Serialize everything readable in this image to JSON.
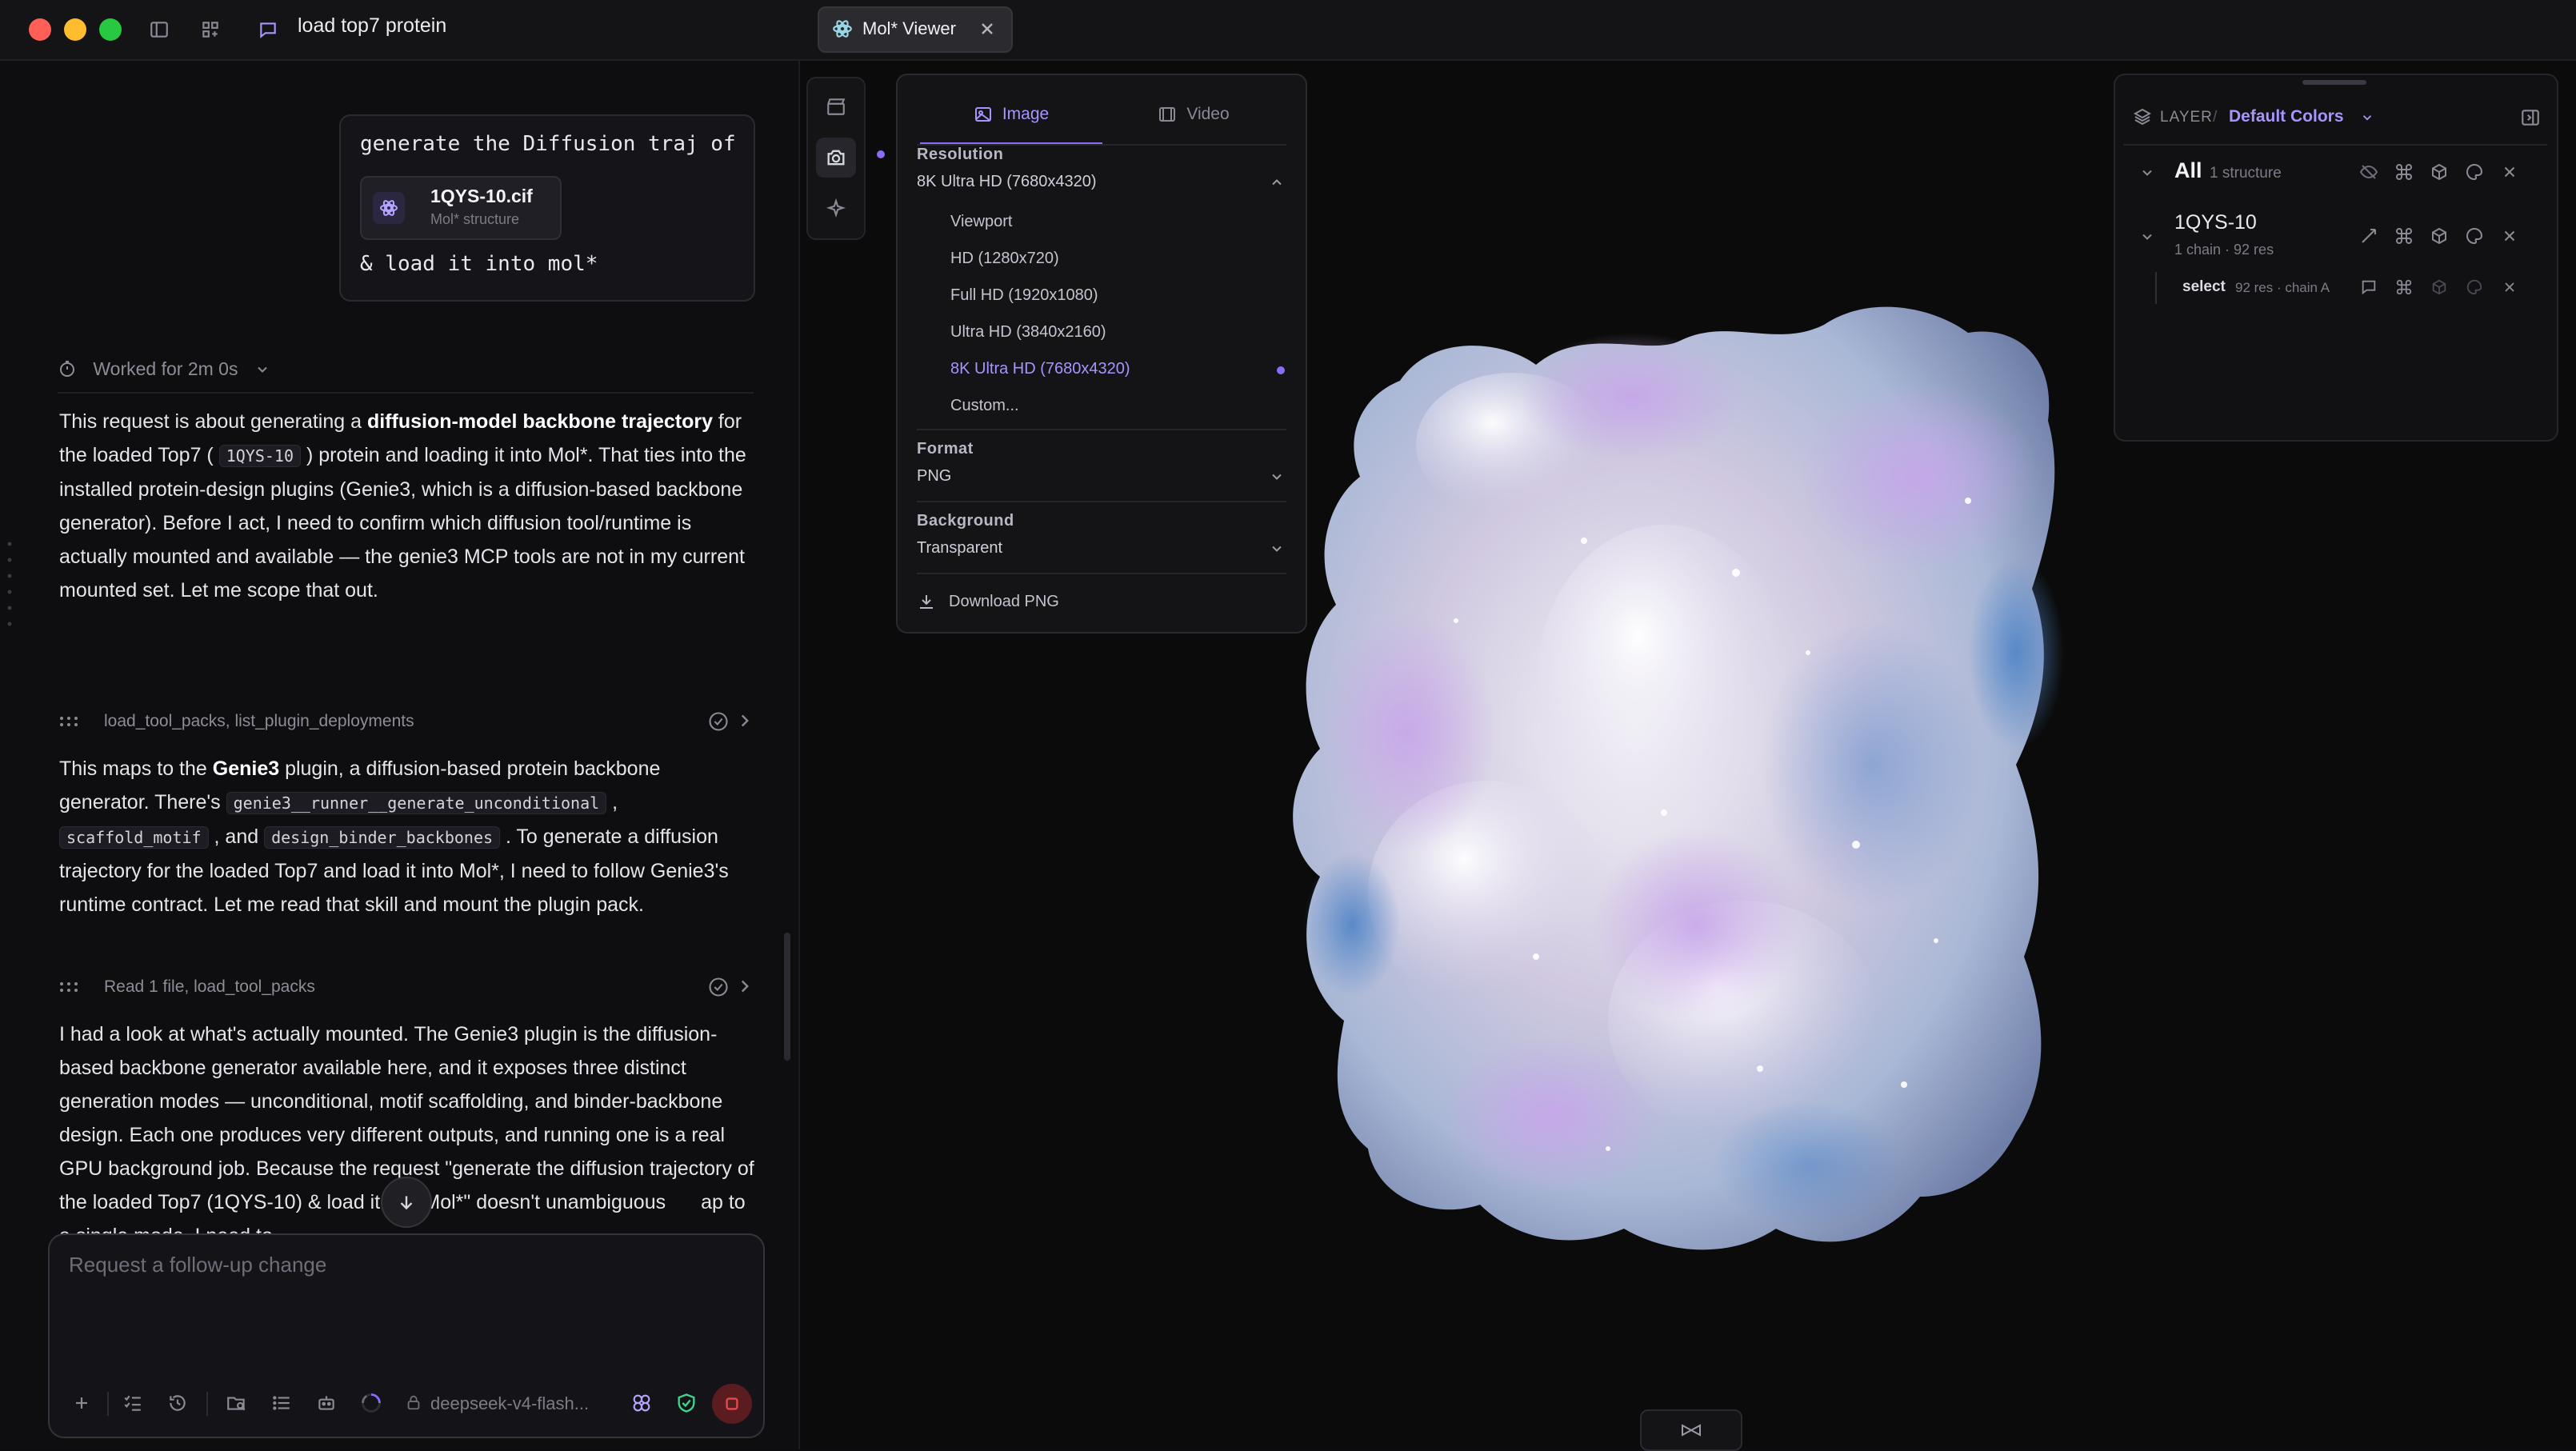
{
  "window": {
    "conversation_title": "load top7 protein",
    "viewer_tab_label": "Mol* Viewer"
  },
  "chat": {
    "user_message": {
      "line1": "generate the Diffusion traj of",
      "file_name": "1QYS-10.cif",
      "file_type": "Mol* structure",
      "line2": "& load it into mol*"
    },
    "worked_label": "Worked for 2m 0s",
    "p1": {
      "a": "This request is about generating a ",
      "b1": "diffusion-model backbone trajectory",
      "c": " for the loaded Top7 ( ",
      "code": "1QYS-10",
      "d": " ) protein and loading it into Mol*. That ties into the installed protein-design plugins (Genie3, which is a diffusion-based backbone generator). Before I act, I need to confirm which diffusion tool/runtime is actually mounted and available — the genie3 MCP tools are not in my current mounted set. Let me scope that out."
    },
    "tool1": "load_tool_packs, list_plugin_deployments",
    "p2": {
      "a": "This maps to the ",
      "b1": "Genie3",
      "c": " plugin, a diffusion-based protein backbone generator. There's ",
      "code1": "genie3__runner__generate_unconditional",
      "d": " , ",
      "code2": "scaffold_motif",
      "e": " , and ",
      "code3": "design_binder_backbones",
      "f": " . To generate a diffusion trajectory for the loaded Top7 and load it into Mol*, I need to follow Genie3's runtime contract. Let me read that skill and mount the plugin pack."
    },
    "tool2": "Read 1 file, load_tool_packs",
    "p3": "I had a look at what's actually mounted. The Genie3 plugin is the diffusion-based backbone generator available here, and it exposes three distinct generation modes — unconditional, motif scaffolding, and binder-backbone design. Each one produces very different outputs, and running one is a real GPU background job. Because the request \"generate the diffusion trajectory of the loaded Top7 (1QYS-10) & load it into Mol*\" doesn't unambiguous",
    "p3_end": "ap to a single mode, I need to",
    "composer": {
      "placeholder": "Request a follow-up change",
      "model": "deepseek-v4-flash..."
    }
  },
  "export_panel": {
    "tabs": [
      "Image",
      "Video"
    ],
    "active_tab": "Image",
    "resolution": {
      "label": "Resolution",
      "value": "8K Ultra HD (7680x4320)",
      "options": [
        "Viewport",
        "HD (1280x720)",
        "Full HD (1920x1080)",
        "Ultra HD (3840x2160)",
        "8K Ultra HD (7680x4320)",
        "Custom..."
      ],
      "selected": "8K Ultra HD (7680x4320)"
    },
    "format": {
      "label": "Format",
      "value": "PNG"
    },
    "background": {
      "label": "Background",
      "value": "Transparent"
    },
    "download_label": "Download PNG"
  },
  "layers_panel": {
    "header_label": "LAYER",
    "separator": "/",
    "scheme": "Default Colors",
    "all": {
      "label": "All",
      "count": "1 structure"
    },
    "structure": {
      "name": "1QYS-10",
      "detail": "1 chain · 92 res"
    },
    "selection": {
      "label": "select",
      "detail": "92 res · chain A"
    }
  },
  "colors": {
    "accent": "#8b6cf6",
    "accent_text": "#a993ff",
    "traffic_red": "#ff5f57",
    "traffic_yellow": "#febc2e",
    "traffic_green": "#28c840",
    "stop_red": "#e5484d",
    "shield_green": "#3dd68c"
  },
  "icons": [
    "sidebar-toggle-icon",
    "layout-grid-icon",
    "chat-bubble-icon",
    "molstar-icon",
    "close-icon",
    "timer-icon",
    "tool-grip-icon",
    "check-circle-icon",
    "chevron-right-icon",
    "arrow-down-icon",
    "plus-icon",
    "checklist-icon",
    "history-icon",
    "folder-search-icon",
    "list-icon",
    "robot-icon",
    "spinner-icon",
    "lock-icon",
    "brain-icon",
    "shield-check-icon",
    "stop-icon",
    "clapperboard-icon",
    "camera-icon",
    "sparkles-icon",
    "image-icon",
    "film-icon",
    "chevron-up-icon",
    "chevron-down-icon",
    "download-icon",
    "layers-icon",
    "collapse-panel-icon",
    "eye-off-icon",
    "command-icon",
    "cube-icon",
    "palette-icon",
    "focus-icon",
    "comment-icon",
    "bowtie-icon"
  ]
}
